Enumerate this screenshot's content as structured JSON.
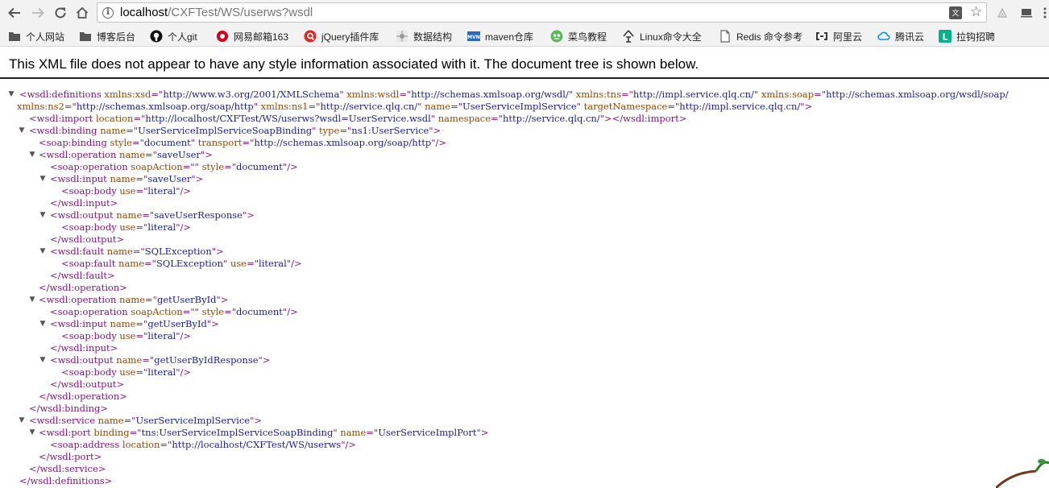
{
  "browser": {
    "url_host": "localhost",
    "url_path": "/CXFTest/WS/userws?wsdl",
    "translate_label": "文"
  },
  "bookmarks": [
    {
      "label": "个人网站",
      "icon": "folder-icon",
      "color": "#444444"
    },
    {
      "label": "博客后台",
      "icon": "folder-icon",
      "color": "#444444"
    },
    {
      "label": "个人git",
      "icon": "github-icon",
      "color": "#000000"
    },
    {
      "label": "网易邮箱163",
      "icon": "netease-mail-icon",
      "color": "#d6001c"
    },
    {
      "label": "jQuery插件库",
      "icon": "jquery-plugin-icon",
      "color": "#e0261f"
    },
    {
      "label": "数据结构",
      "icon": "data-structure-icon",
      "color": "#8a8a8a"
    },
    {
      "label": "maven仓库",
      "icon": "maven-icon",
      "color": "#2c68b5"
    },
    {
      "label": "菜鸟教程",
      "icon": "runoob-icon",
      "color": "#5db75d"
    },
    {
      "label": "Linux命令大全",
      "icon": "linux-command-icon",
      "color": "#333333"
    },
    {
      "label": "Redis 命令参考",
      "icon": "page-icon",
      "color": "#666666"
    },
    {
      "label": "阿里云",
      "icon": "aliyun-icon",
      "color": "#222222"
    },
    {
      "label": "腾讯云",
      "icon": "tencent-cloud-icon",
      "color": "#0d8fe9"
    },
    {
      "label": "拉钩招聘",
      "icon": "lagou-icon",
      "color": "#00b38a"
    }
  ],
  "page": {
    "notice": "This XML file does not appear to have any style information associated with it. The document tree is shown below."
  },
  "xml_lines": [
    {
      "toggle": "▼",
      "segs": [
        [
          "tg",
          "<wsdl:definitions "
        ],
        [
          "an",
          "xmlns:xsd"
        ],
        [
          "tg",
          "=\""
        ],
        [
          "av",
          "http://www.w3.org/2001/XMLSchema"
        ],
        [
          "tg",
          "\" "
        ],
        [
          "an",
          "xmlns:wsdl"
        ],
        [
          "tg",
          "=\""
        ],
        [
          "av",
          "http://schemas.xmlsoap.org/wsdl/"
        ],
        [
          "tg",
          "\" "
        ],
        [
          "an",
          "xmlns:tns"
        ],
        [
          "tg",
          "=\""
        ],
        [
          "av",
          "http://impl.service.qlq.cn/"
        ],
        [
          "tg",
          "\" "
        ],
        [
          "an",
          "xmlns:soap"
        ],
        [
          "tg",
          "=\""
        ],
        [
          "av",
          "http://schemas.xmlsoap.org/wsdl/soap/"
        ]
      ]
    },
    {
      "toggle": "",
      "segs": [
        [
          "an",
          "xmlns:ns2"
        ],
        [
          "tg",
          "=\""
        ],
        [
          "av",
          "http://schemas.xmlsoap.org/soap/http"
        ],
        [
          "tg",
          "\" "
        ],
        [
          "an",
          "xmlns:ns1"
        ],
        [
          "tg",
          "=\""
        ],
        [
          "av",
          "http://service.qlq.cn/"
        ],
        [
          "tg",
          "\" "
        ],
        [
          "an",
          "name"
        ],
        [
          "tg",
          "=\""
        ],
        [
          "av",
          "UserServiceImplService"
        ],
        [
          "tg",
          "\" "
        ],
        [
          "an",
          "targetNamespace"
        ],
        [
          "tg",
          "=\""
        ],
        [
          "av",
          "http://impl.service.qlq.cn/"
        ],
        [
          "tg",
          "\">"
        ]
      ]
    },
    {
      "toggle": "",
      "segs": [
        [
          "tg",
          "<wsdl:import "
        ],
        [
          "an",
          "location"
        ],
        [
          "tg",
          "=\""
        ],
        [
          "av",
          "http://localhost/CXFTest/WS/userws?wsdl=UserService.wsdl"
        ],
        [
          "tg",
          "\" "
        ],
        [
          "an",
          "namespace"
        ],
        [
          "tg",
          "=\""
        ],
        [
          "av",
          "http://service.qlq.cn/"
        ],
        [
          "tg",
          "\"></wsdl:import>"
        ]
      ]
    },
    {
      "toggle": "▼",
      "segs": [
        [
          "tg",
          "<wsdl:binding "
        ],
        [
          "an",
          "name"
        ],
        [
          "tg",
          "=\""
        ],
        [
          "av",
          "UserServiceImplServiceSoapBinding"
        ],
        [
          "tg",
          "\" "
        ],
        [
          "an",
          "type"
        ],
        [
          "tg",
          "=\""
        ],
        [
          "av",
          "ns1:UserService"
        ],
        [
          "tg",
          "\">"
        ]
      ]
    },
    {
      "toggle": "",
      "segs": [
        [
          "tg",
          "<soap:binding "
        ],
        [
          "an",
          "style"
        ],
        [
          "tg",
          "=\""
        ],
        [
          "av",
          "document"
        ],
        [
          "tg",
          "\" "
        ],
        [
          "an",
          "transport"
        ],
        [
          "tg",
          "=\""
        ],
        [
          "av",
          "http://schemas.xmlsoap.org/soap/http"
        ],
        [
          "tg",
          "\"/>"
        ]
      ]
    },
    {
      "toggle": "▼",
      "segs": [
        [
          "tg",
          "<wsdl:operation "
        ],
        [
          "an",
          "name"
        ],
        [
          "tg",
          "=\""
        ],
        [
          "av",
          "saveUser"
        ],
        [
          "tg",
          "\">"
        ]
      ]
    },
    {
      "toggle": "",
      "segs": [
        [
          "tg",
          "<soap:operation "
        ],
        [
          "an",
          "soapAction"
        ],
        [
          "tg",
          "=\"\" "
        ],
        [
          "an",
          "style"
        ],
        [
          "tg",
          "=\""
        ],
        [
          "av",
          "document"
        ],
        [
          "tg",
          "\"/>"
        ]
      ]
    },
    {
      "toggle": "▼",
      "segs": [
        [
          "tg",
          "<wsdl:input "
        ],
        [
          "an",
          "name"
        ],
        [
          "tg",
          "=\""
        ],
        [
          "av",
          "saveUser"
        ],
        [
          "tg",
          "\">"
        ]
      ]
    },
    {
      "toggle": "",
      "segs": [
        [
          "tg",
          "<soap:body "
        ],
        [
          "an",
          "use"
        ],
        [
          "tg",
          "=\""
        ],
        [
          "av",
          "literal"
        ],
        [
          "tg",
          "\"/>"
        ]
      ]
    },
    {
      "toggle": "",
      "segs": [
        [
          "tg",
          "</wsdl:input>"
        ]
      ]
    },
    {
      "toggle": "▼",
      "segs": [
        [
          "tg",
          "<wsdl:output "
        ],
        [
          "an",
          "name"
        ],
        [
          "tg",
          "=\""
        ],
        [
          "av",
          "saveUserResponse"
        ],
        [
          "tg",
          "\">"
        ]
      ]
    },
    {
      "toggle": "",
      "segs": [
        [
          "tg",
          "<soap:body "
        ],
        [
          "an",
          "use"
        ],
        [
          "tg",
          "=\""
        ],
        [
          "av",
          "literal"
        ],
        [
          "tg",
          "\"/>"
        ]
      ]
    },
    {
      "toggle": "",
      "segs": [
        [
          "tg",
          "</wsdl:output>"
        ]
      ]
    },
    {
      "toggle": "▼",
      "segs": [
        [
          "tg",
          "<wsdl:fault "
        ],
        [
          "an",
          "name"
        ],
        [
          "tg",
          "=\""
        ],
        [
          "av",
          "SQLException"
        ],
        [
          "tg",
          "\">"
        ]
      ]
    },
    {
      "toggle": "",
      "segs": [
        [
          "tg",
          "<soap:fault "
        ],
        [
          "an",
          "name"
        ],
        [
          "tg",
          "=\""
        ],
        [
          "av",
          "SQLException"
        ],
        [
          "tg",
          "\" "
        ],
        [
          "an",
          "use"
        ],
        [
          "tg",
          "=\""
        ],
        [
          "av",
          "literal"
        ],
        [
          "tg",
          "\"/>"
        ]
      ]
    },
    {
      "toggle": "",
      "segs": [
        [
          "tg",
          "</wsdl:fault>"
        ]
      ]
    },
    {
      "toggle": "",
      "segs": [
        [
          "tg",
          "</wsdl:operation>"
        ]
      ]
    },
    {
      "toggle": "▼",
      "segs": [
        [
          "tg",
          "<wsdl:operation "
        ],
        [
          "an",
          "name"
        ],
        [
          "tg",
          "=\""
        ],
        [
          "av",
          "getUserById"
        ],
        [
          "tg",
          "\">"
        ]
      ]
    },
    {
      "toggle": "",
      "segs": [
        [
          "tg",
          "<soap:operation "
        ],
        [
          "an",
          "soapAction"
        ],
        [
          "tg",
          "=\"\" "
        ],
        [
          "an",
          "style"
        ],
        [
          "tg",
          "=\""
        ],
        [
          "av",
          "document"
        ],
        [
          "tg",
          "\"/>"
        ]
      ]
    },
    {
      "toggle": "▼",
      "segs": [
        [
          "tg",
          "<wsdl:input "
        ],
        [
          "an",
          "name"
        ],
        [
          "tg",
          "=\""
        ],
        [
          "av",
          "getUserById"
        ],
        [
          "tg",
          "\">"
        ]
      ]
    },
    {
      "toggle": "",
      "segs": [
        [
          "tg",
          "<soap:body "
        ],
        [
          "an",
          "use"
        ],
        [
          "tg",
          "=\""
        ],
        [
          "av",
          "literal"
        ],
        [
          "tg",
          "\"/>"
        ]
      ]
    },
    {
      "toggle": "",
      "segs": [
        [
          "tg",
          "</wsdl:input>"
        ]
      ]
    },
    {
      "toggle": "▼",
      "segs": [
        [
          "tg",
          "<wsdl:output "
        ],
        [
          "an",
          "name"
        ],
        [
          "tg",
          "=\""
        ],
        [
          "av",
          "getUserByIdResponse"
        ],
        [
          "tg",
          "\">"
        ]
      ]
    },
    {
      "toggle": "",
      "segs": [
        [
          "tg",
          "<soap:body "
        ],
        [
          "an",
          "use"
        ],
        [
          "tg",
          "=\""
        ],
        [
          "av",
          "literal"
        ],
        [
          "tg",
          "\"/>"
        ]
      ]
    },
    {
      "toggle": "",
      "segs": [
        [
          "tg",
          "</wsdl:output>"
        ]
      ]
    },
    {
      "toggle": "",
      "segs": [
        [
          "tg",
          "</wsdl:operation>"
        ]
      ]
    },
    {
      "toggle": "",
      "segs": [
        [
          "tg",
          "</wsdl:binding>"
        ]
      ]
    },
    {
      "toggle": "▼",
      "segs": [
        [
          "tg",
          "<wsdl:service "
        ],
        [
          "an",
          "name"
        ],
        [
          "tg",
          "=\""
        ],
        [
          "av",
          "UserServiceImplService"
        ],
        [
          "tg",
          "\">"
        ]
      ]
    },
    {
      "toggle": "▼",
      "segs": [
        [
          "tg",
          "<wsdl:port "
        ],
        [
          "an",
          "binding"
        ],
        [
          "tg",
          "=\""
        ],
        [
          "av",
          "tns:UserServiceImplServiceSoapBinding"
        ],
        [
          "tg",
          "\" "
        ],
        [
          "an",
          "name"
        ],
        [
          "tg",
          "=\""
        ],
        [
          "av",
          "UserServiceImplPort"
        ],
        [
          "tg",
          "\">"
        ]
      ]
    },
    {
      "toggle": "",
      "segs": [
        [
          "tg",
          "<soap:address "
        ],
        [
          "an",
          "location"
        ],
        [
          "tg",
          "=\""
        ],
        [
          "av",
          "http://localhost/CXFTest/WS/userws"
        ],
        [
          "tg",
          "\"/>"
        ]
      ]
    },
    {
      "toggle": "",
      "segs": [
        [
          "tg",
          "</wsdl:port>"
        ]
      ]
    },
    {
      "toggle": "",
      "segs": [
        [
          "tg",
          "</wsdl:service>"
        ]
      ]
    },
    {
      "toggle": "",
      "segs": [
        [
          "tg",
          "</wsdl:definitions>"
        ]
      ]
    }
  ]
}
